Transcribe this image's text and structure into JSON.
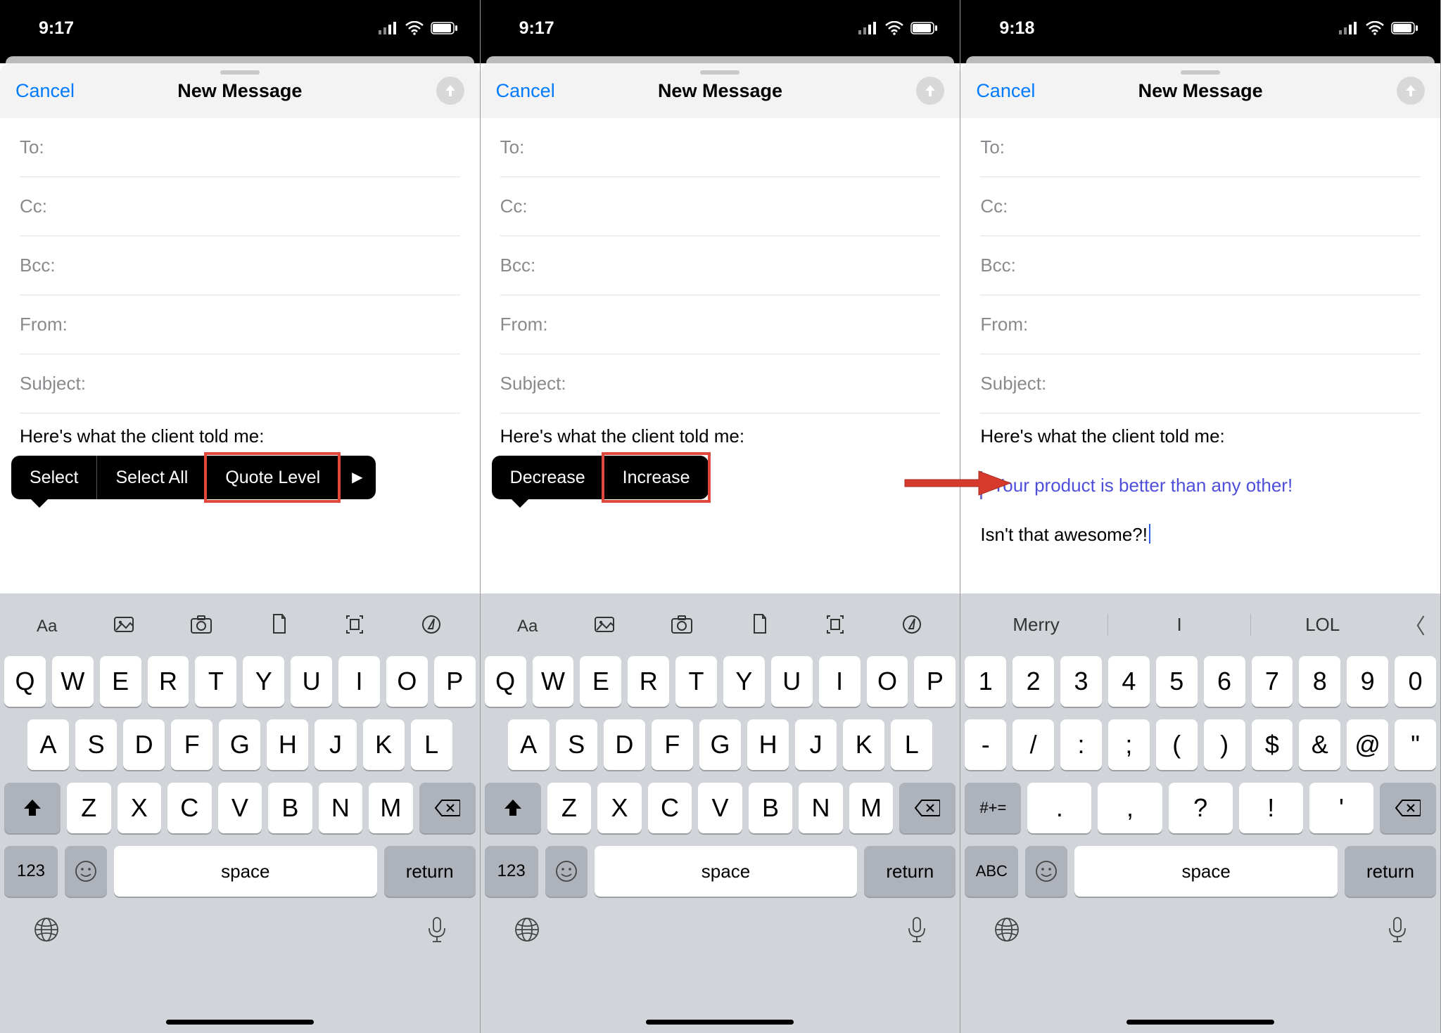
{
  "screens": [
    {
      "time": "9:17",
      "popup": [
        "Select",
        "Select All",
        "Quote Level"
      ],
      "popup_arrow": true,
      "highlight_idx": 2,
      "kb_mode": "alpha",
      "kb_toolbar": "icons"
    },
    {
      "time": "9:17",
      "popup": [
        "Decrease",
        "Increase"
      ],
      "popup_arrow": false,
      "highlight_idx": 1,
      "kb_mode": "alpha",
      "kb_toolbar": "icons"
    },
    {
      "time": "9:18",
      "popup": null,
      "kb_mode": "numeric",
      "kb_toolbar": "suggest",
      "show_result": true
    }
  ],
  "nav": {
    "cancel": "Cancel",
    "title": "New Message"
  },
  "fields": {
    "to": "To:",
    "cc": "Cc:",
    "bcc": "Bcc:",
    "from": "From:",
    "subject": "Subject:"
  },
  "body": {
    "intro": "Here's what the client told me:",
    "quote": "Your product is better than any other!",
    "outro": "Isn't that awesome?!"
  },
  "suggestions": [
    "Merry",
    "I",
    "LOL"
  ],
  "keys_row1_alpha": [
    "Q",
    "W",
    "E",
    "R",
    "T",
    "Y",
    "U",
    "I",
    "O",
    "P"
  ],
  "keys_row2_alpha": [
    "A",
    "S",
    "D",
    "F",
    "G",
    "H",
    "J",
    "K",
    "L"
  ],
  "keys_row3_alpha": [
    "Z",
    "X",
    "C",
    "V",
    "B",
    "N",
    "M"
  ],
  "keys_row1_num": [
    "1",
    "2",
    "3",
    "4",
    "5",
    "6",
    "7",
    "8",
    "9",
    "0"
  ],
  "keys_row2_num": [
    "-",
    "/",
    ":",
    ";",
    "(",
    ")",
    "$",
    "&",
    "@",
    "\""
  ],
  "keys_row3_num": [
    ".",
    ",",
    "?",
    "!",
    "'"
  ],
  "key_123": "123",
  "key_abc": "ABC",
  "key_sym": "#+=",
  "key_space": "space",
  "key_return": "return"
}
